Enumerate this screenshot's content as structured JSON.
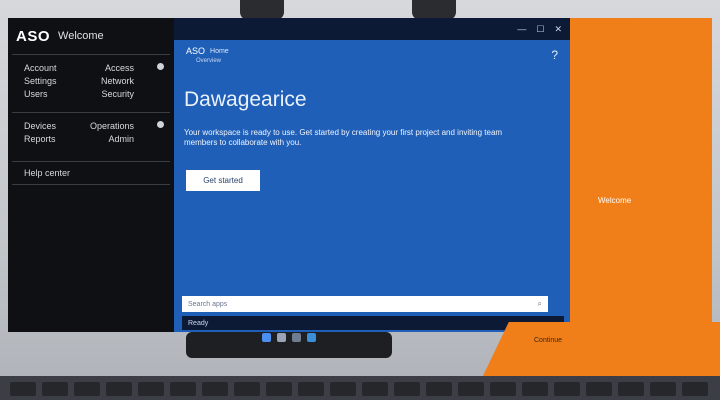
{
  "brand": {
    "logo": "ASO",
    "title": "Welcome"
  },
  "sidebar": {
    "groups": [
      {
        "rows": [
          [
            "Account",
            "Access"
          ],
          [
            "Settings",
            "Network"
          ],
          [
            "Users",
            "Security"
          ]
        ]
      },
      {
        "rows": [
          [
            "Devices",
            "Operations"
          ],
          [
            "Reports",
            "Admin"
          ]
        ]
      }
    ],
    "footer_item": "Help center"
  },
  "main": {
    "mini_logo": "ASO",
    "sub_text": "Home",
    "sub_text2": "Overview",
    "headline": "Dawagearice",
    "description": "Your workspace is ready to use. Get started by creating your first project and inviting team members to collaborate with you.",
    "cta_label": "Get started",
    "search_placeholder": "Search apps",
    "status_text": "Ready"
  },
  "orange": {
    "label": "Welcome",
    "spill_label": "Continue"
  },
  "colors": {
    "blue": "#1f5fb8",
    "orange": "#f07f1a",
    "dark": "#0e1014"
  }
}
